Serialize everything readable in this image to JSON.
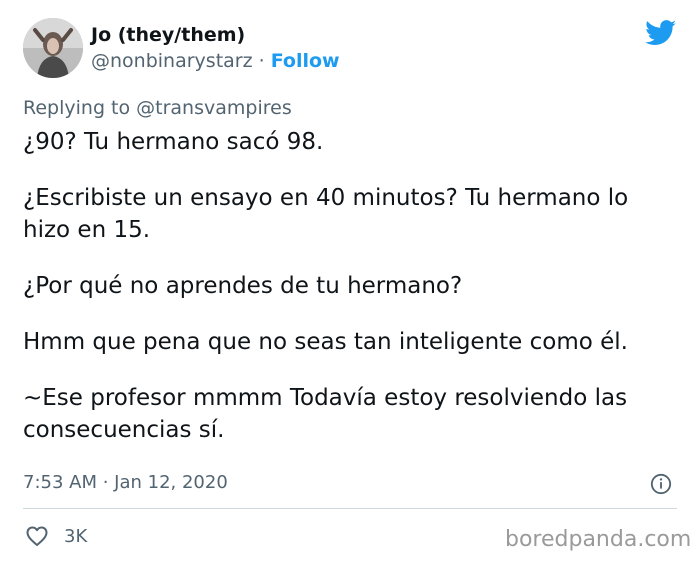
{
  "tweet": {
    "display_name": "Jo (they/them)",
    "handle": "@nonbinarystarz",
    "separator": " · ",
    "follow_label": "Follow",
    "replying_to_prefix": "Replying to ",
    "replying_to_handle": "@transvampires",
    "paragraphs": [
      "¿90? Tu hermano sacó 98.",
      "¿Escribiste un ensayo en 40 minutos? Tu hermano lo\nhizo en 15.",
      "¿Por qué no aprendes de tu hermano?",
      "Hmm que pena que no seas tan inteligente como él.",
      "~Ese profesor mmmm Todavía estoy resolviendo las\nconsecuencias sí."
    ],
    "timestamp": "7:53 AM · Jan 12, 2020",
    "like_count": "3K"
  },
  "watermark": "boredpanda.com",
  "icons": {
    "brand": "twitter-bird-icon",
    "info": "info-icon",
    "like": "heart-icon"
  },
  "colors": {
    "accent": "#1d9bf0",
    "text": "#0f1419",
    "secondary": "#536471",
    "divider": "#cfd9de"
  }
}
